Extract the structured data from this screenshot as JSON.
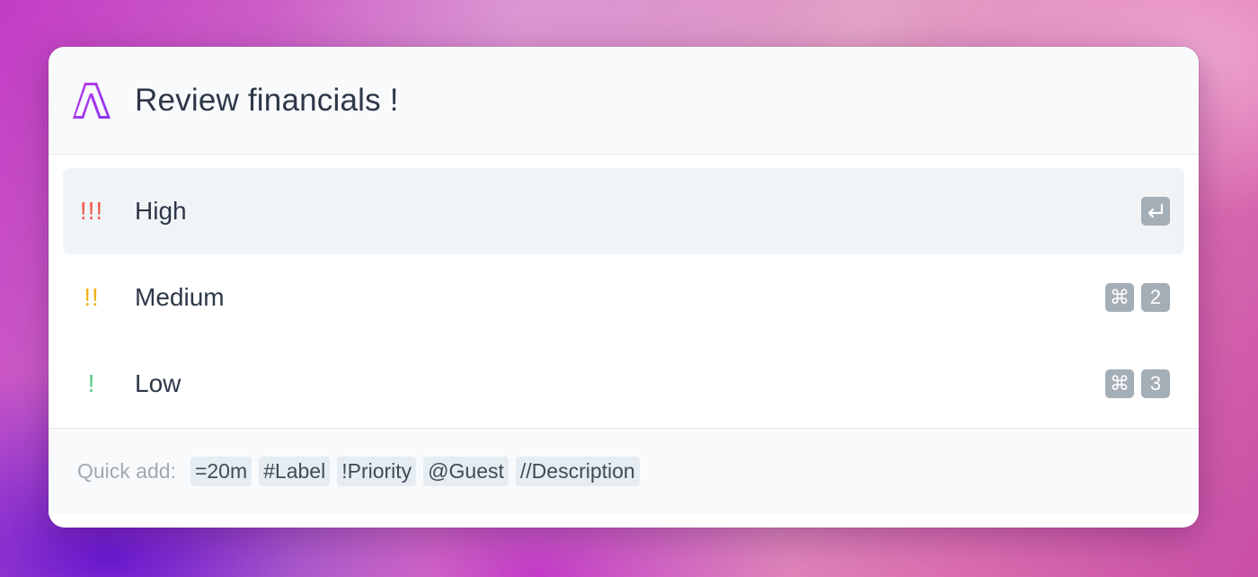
{
  "task": {
    "title": "Review financials !",
    "logo_icon": "app-logo-icon"
  },
  "priorities": [
    {
      "marks": "!!!",
      "label": "High",
      "color": "#ef5a4c",
      "shortcut": [
        "↵"
      ],
      "selected": true
    },
    {
      "marks": "!!",
      "label": "Medium",
      "color": "#f2b21c",
      "shortcut": [
        "⌘",
        "2"
      ],
      "selected": false
    },
    {
      "marks": "!",
      "label": "Low",
      "color": "#5ccb8a",
      "shortcut": [
        "⌘",
        "3"
      ],
      "selected": false
    }
  ],
  "quick_add": {
    "label": "Quick add:",
    "chips": [
      "=20m",
      "#Label",
      "!Priority",
      "@Guest",
      "//Description"
    ]
  },
  "colors": {
    "accent": "#a93cf0",
    "selected_bg": "#f0f4f7",
    "key_bg": "#a4aeb7"
  }
}
